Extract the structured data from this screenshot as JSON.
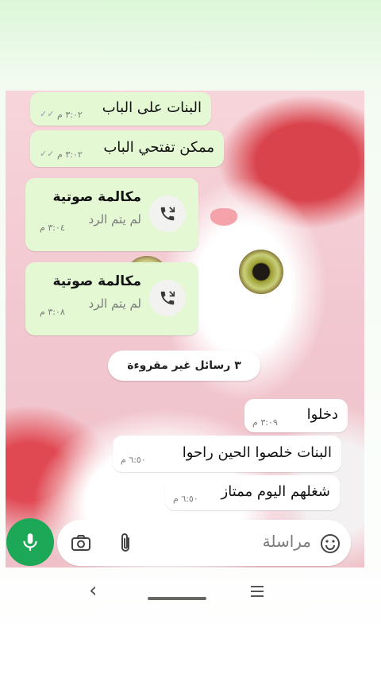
{
  "messages": [
    {
      "text": "البنات على الباب",
      "time": "٣:٠٢ م",
      "ticks": "✓✓"
    },
    {
      "text": "ممكن تفتحي الباب",
      "time": "٣:٠٢ م",
      "ticks": "✓✓"
    }
  ],
  "calls": [
    {
      "title": "مكالمة صوتية",
      "status": "لم يتم الرد",
      "time": "٣:٠٤ م"
    },
    {
      "title": "مكالمة صوتية",
      "status": "لم يتم الرد",
      "time": "٣:٠٨ م"
    }
  ],
  "unread_banner": "٣ رسائل غير مقروءة",
  "incoming": [
    {
      "text": "دخلوا",
      "time": "٣:٠٩ م"
    },
    {
      "text": "البنات خلصوا الحين راحوا",
      "time": "٦:٥٠ م"
    },
    {
      "text": "شغلهم اليوم ممتاز",
      "time": "٦:٥٠ م"
    }
  ],
  "input": {
    "placeholder": "مراسلة"
  },
  "icons": {
    "mic": "mic-icon",
    "camera": "camera-icon",
    "attach": "paperclip-icon",
    "emoji": "emoji-icon",
    "call": "missed-call-icon"
  },
  "colors": {
    "outgoing_bubble": "#e4f8d4",
    "incoming_bubble": "#ffffff",
    "mic_button": "#1da858"
  }
}
